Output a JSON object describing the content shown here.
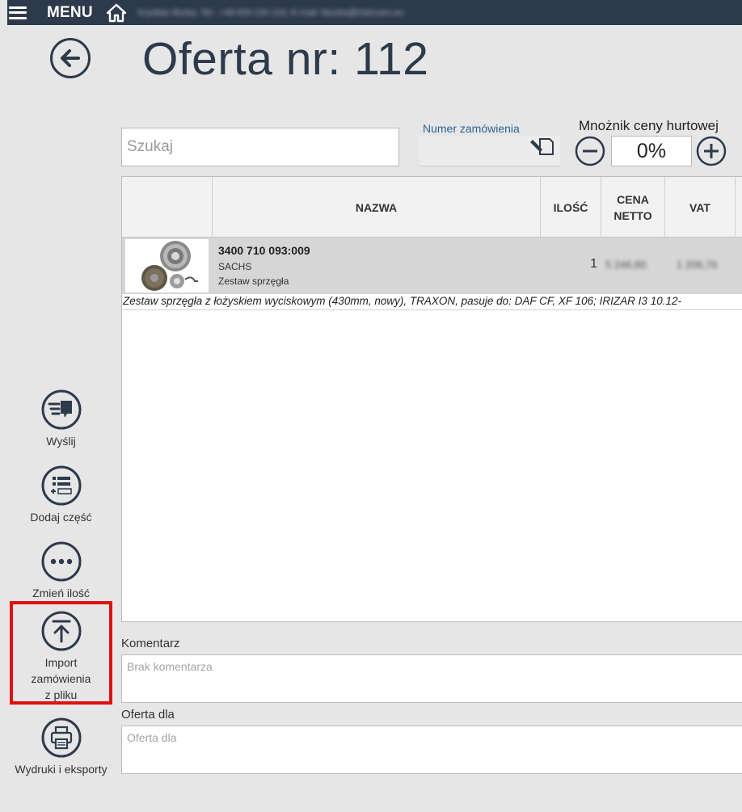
{
  "topbar": {
    "menu_label": "MENU",
    "user_info": "Krystian Burka, Tel.: +48 609 230 216, E-mail: kburka@intercars.eu"
  },
  "page": {
    "title": "Oferta nr: 112"
  },
  "search": {
    "placeholder": "Szukaj",
    "value": ""
  },
  "order": {
    "label": "Numer zamówienia",
    "value": ""
  },
  "multiplier": {
    "label": "Mnożnik ceny hurtowej",
    "value": "0%"
  },
  "table": {
    "columns": [
      {
        "key": "image",
        "label": ""
      },
      {
        "key": "name",
        "label": "NAZWA"
      },
      {
        "key": "qty",
        "label": "ILOŚĆ"
      },
      {
        "key": "price",
        "label": "CENA NETTO"
      },
      {
        "key": "vat",
        "label": "VAT"
      }
    ],
    "rows": [
      {
        "part_no": "3400 710 093:009",
        "brand": "SACHS",
        "name": "Zestaw sprzęgła",
        "qty": "1",
        "price": "5 246,80",
        "vat": "1 206,76",
        "description": "Zestaw sprzęgła z łożyskiem wyciskowym (430mm, nowy), TRAXON, pasuje do: DAF CF, XF 106; IRIZAR I3 10.12-"
      }
    ]
  },
  "comment": {
    "label": "Komentarz",
    "placeholder": "Brak komentarza"
  },
  "offer_for": {
    "label": "Oferta dla",
    "placeholder": "Oferta dla"
  },
  "actions": {
    "send": "Wyślij",
    "add_part": "Dodaj część",
    "change_qty": "Zmień ilość",
    "import_line1": "Import",
    "import_line2": "zamówienia",
    "import_line3": "z pliku",
    "print": "Wydruki i eksporty"
  },
  "colors": {
    "topbar": "#2d3a4b",
    "accent": "#2a6496",
    "highlight": "#e01010",
    "row_bg": "#d6d6d6"
  }
}
